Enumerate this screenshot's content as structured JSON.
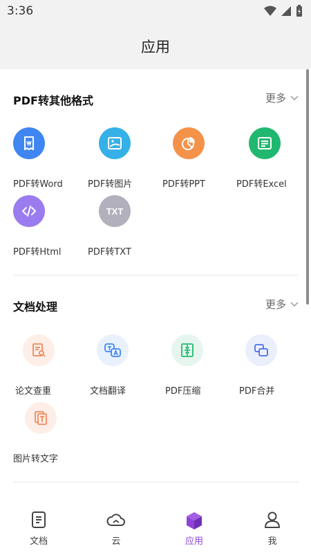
{
  "status_bar": {
    "time": "3:36"
  },
  "header": {
    "title": "应用"
  },
  "sections": [
    {
      "title": "PDF转其他格式",
      "more": "更多",
      "items": [
        {
          "label": "PDF转Word",
          "icon": "word-doc-icon",
          "color": "#3f86f2"
        },
        {
          "label": "PDF转图片",
          "icon": "image-icon",
          "color": "#35b1e8"
        },
        {
          "label": "PDF转PPT",
          "icon": "pie-chart-icon",
          "color": "#f5924a"
        },
        {
          "label": "PDF转Excel",
          "icon": "spreadsheet-icon",
          "color": "#1fb86e"
        },
        {
          "label": "PDF转Html",
          "icon": "code-icon",
          "color": "#9a7cf0"
        },
        {
          "label": "PDF转TXT",
          "icon": "txt-icon",
          "color": "#b1b0bc",
          "badge": "TXT"
        }
      ]
    },
    {
      "title": "文档处理",
      "more": "更多",
      "items": [
        {
          "label": "论文查重",
          "icon": "document-search-icon",
          "color": "#f0875a",
          "bg": "#fdeee7"
        },
        {
          "label": "文档翻译",
          "icon": "translate-icon",
          "color": "#3f86f2",
          "bg": "#e9f1fd"
        },
        {
          "label": "PDF压缩",
          "icon": "compress-icon",
          "color": "#1fb86e",
          "bg": "#e6f6ee"
        },
        {
          "label": "PDF合并",
          "icon": "merge-icon",
          "color": "#4a6fe6",
          "bg": "#ebeffc"
        },
        {
          "label": "图片转文字",
          "icon": "image-to-text-icon",
          "color": "#f0875a",
          "bg": "#fdeee7"
        }
      ]
    }
  ],
  "tabs": [
    {
      "label": "文档",
      "icon": "document-tab-icon",
      "active": false
    },
    {
      "label": "云",
      "icon": "cloud-icon",
      "active": false
    },
    {
      "label": "应用",
      "icon": "apps-cube-icon",
      "active": true
    },
    {
      "label": "我",
      "icon": "user-icon",
      "active": false
    }
  ],
  "colors": {
    "accent": "#8e44d6",
    "header_bg": "#f2f2f2"
  }
}
